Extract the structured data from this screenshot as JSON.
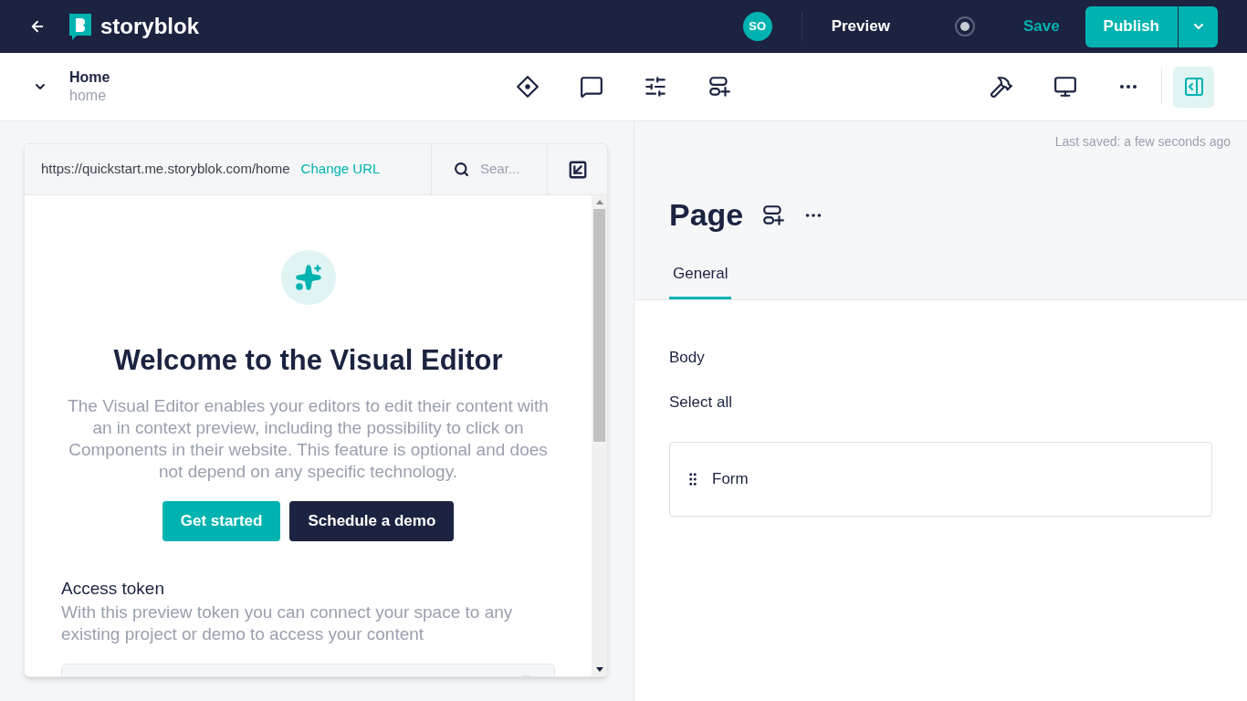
{
  "topbar": {
    "logo": "storyblok",
    "avatar": "SO",
    "preview": "Preview",
    "save": "Save",
    "publish": "Publish"
  },
  "story": {
    "title": "Home",
    "slug": "home"
  },
  "preview": {
    "url": "https://quickstart.me.storyblok.com/home",
    "change_url": "Change URL",
    "search_placeholder": "Sear...",
    "heading": "Welcome to the Visual Editor",
    "intro": "The Visual Editor enables your editors to edit their content with an in context preview, including the possibility to click on Components in their website. This feature is optional and does not depend on any specific technology.",
    "buttons": [
      {
        "label": "Get started",
        "kind": "primary"
      },
      {
        "label": "Schedule a demo",
        "kind": "dark"
      }
    ],
    "token_title": "Access token",
    "token_text": "With this preview token you can connect your space to any existing project or demo to access your content"
  },
  "editor": {
    "last_saved": "Last saved: a few seconds ago",
    "title": "Page",
    "tabs": [
      {
        "label": "General",
        "selected": true
      }
    ],
    "field_label": "Body",
    "select_all": "Select all",
    "blocks": [
      {
        "name": "Form"
      }
    ]
  }
}
